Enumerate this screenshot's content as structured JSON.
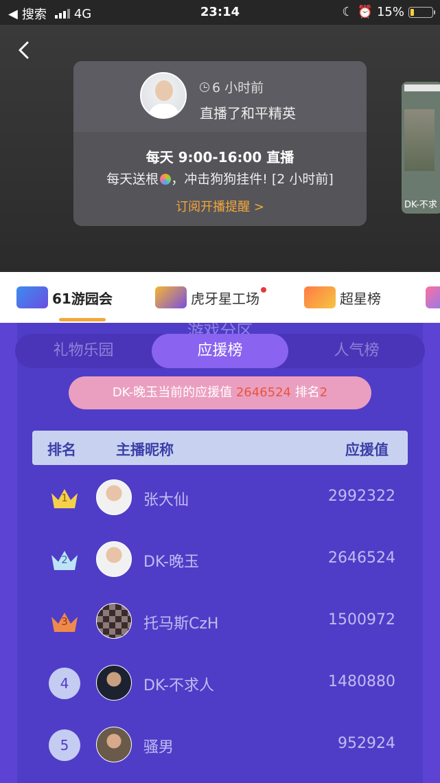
{
  "status_bar": {
    "carrier": "搜索",
    "network": "4G",
    "time": "23:14",
    "battery": "15%"
  },
  "live_card": {
    "time_ago": "6 小时前",
    "played": "直播了和平精英",
    "schedule": "每天 9:00-16:00 直播",
    "gift_text_a": "每天送根",
    "gift_text_b": "，冲击狗狗挂件!",
    "gift_time": "[2 小时前]",
    "subscribe": "订阅开播提醒 >",
    "thumb_label": "DK-不求"
  },
  "tabs": [
    {
      "label": "61游园会",
      "active": true
    },
    {
      "label": "虎牙星工场",
      "active": false,
      "dot": true
    },
    {
      "label": "超星榜",
      "active": false
    }
  ],
  "ghost_title": "游戏分区",
  "segments": [
    {
      "label": "礼物乐园",
      "active": false
    },
    {
      "label": "应援榜",
      "active": true
    },
    {
      "label": "人气榜",
      "active": false
    }
  ],
  "notice": {
    "prefix": "DK-晚玉当前的应援值 ",
    "value": "2646524",
    "mid": " 排名",
    "rank": "2"
  },
  "table_header": {
    "rank": "排名",
    "name": "主播昵称",
    "score": "应援值"
  },
  "rows": [
    {
      "rank": "1",
      "name": "张大仙",
      "score": "2992322"
    },
    {
      "rank": "2",
      "name": "DK-晚玉",
      "score": "2646524"
    },
    {
      "rank": "3",
      "name": "托马斯CzH",
      "score": "1500972"
    },
    {
      "rank": "4",
      "name": "DK-不求人",
      "score": "1480880"
    },
    {
      "rank": "5",
      "name": "骚男",
      "score": "952924"
    }
  ],
  "colors": {
    "accent": "#F2A83A",
    "purple_bg": "#5D43D4",
    "segment_active": "#8A63F0",
    "highlight_red": "#E8543E"
  }
}
